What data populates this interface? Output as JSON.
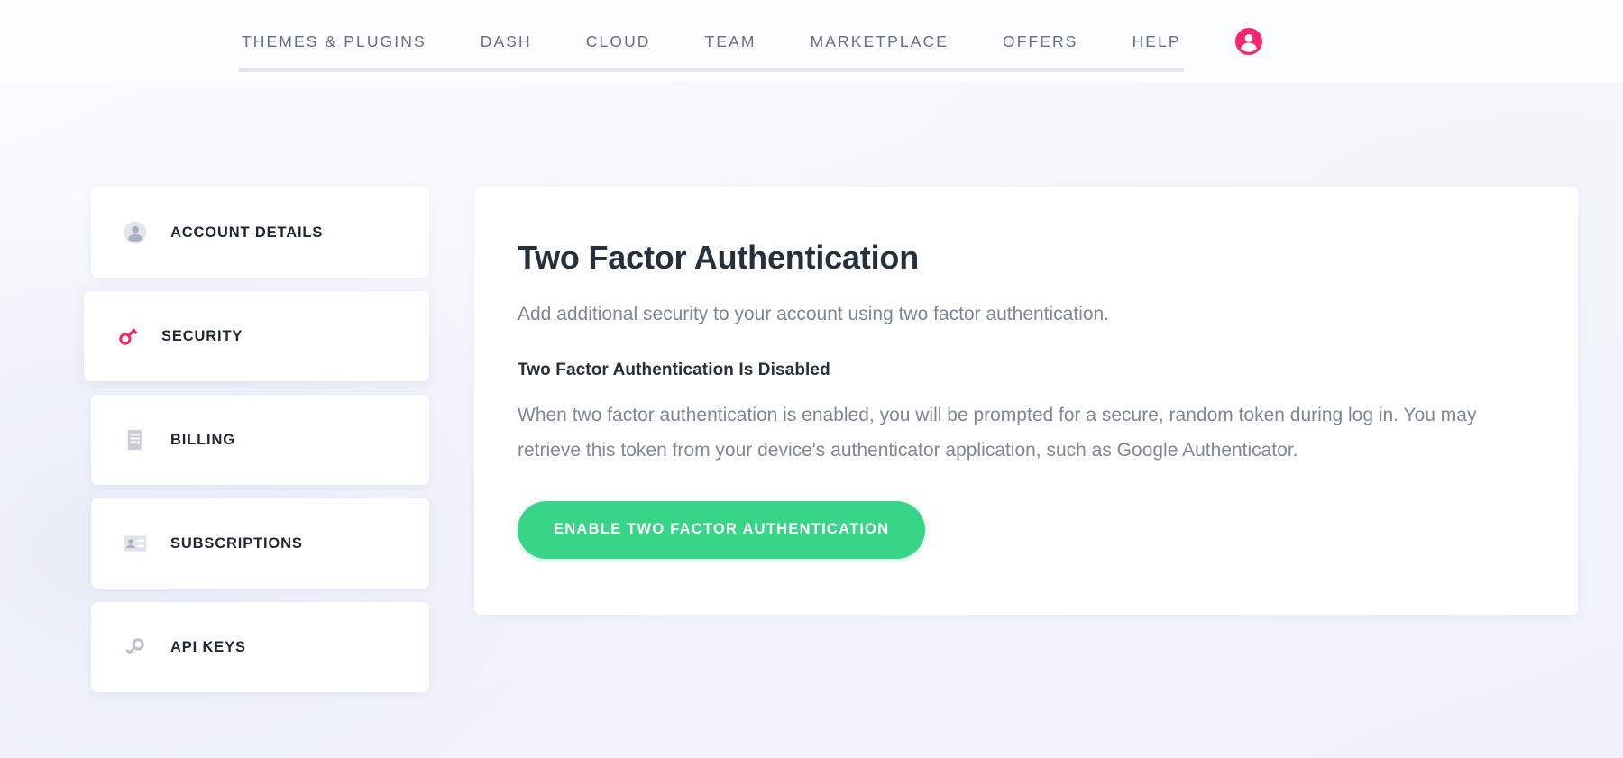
{
  "nav": {
    "items": [
      {
        "label": "THEMES & PLUGINS",
        "name": "nav-item-themes-plugins"
      },
      {
        "label": "DASH",
        "name": "nav-item-dash"
      },
      {
        "label": "CLOUD",
        "name": "nav-item-cloud"
      },
      {
        "label": "TEAM",
        "name": "nav-item-team"
      },
      {
        "label": "MARKETPLACE",
        "name": "nav-item-marketplace"
      },
      {
        "label": "OFFERS",
        "name": "nav-item-offers"
      },
      {
        "label": "HELP",
        "name": "nav-item-help"
      }
    ],
    "avatar_icon": "user-avatar-icon"
  },
  "sidebar": {
    "items": [
      {
        "label": "ACCOUNT DETAILS",
        "icon": "user-avatar-icon",
        "active": false
      },
      {
        "label": "SECURITY",
        "icon": "key-icon",
        "active": true
      },
      {
        "label": "BILLING",
        "icon": "receipt-icon",
        "active": false
      },
      {
        "label": "SUBSCRIPTIONS",
        "icon": "id-card-icon",
        "active": false
      },
      {
        "label": "API KEYS",
        "icon": "key-icon",
        "active": false
      }
    ]
  },
  "main": {
    "title": "Two Factor Authentication",
    "subtitle": "Add additional security to your account using two factor authentication.",
    "status_heading": "Two Factor Authentication Is Disabled",
    "description": "When two factor authentication is enabled, you will be prompted for a secure, random token during log in. You may retrieve this token from your device's authenticator application, such as Google Authenticator.",
    "enable_button_label": "ENABLE TWO FACTOR AUTHENTICATION"
  },
  "colors": {
    "accent_pink": "#f5276f",
    "button_green": "#38d487",
    "nav_text": "#656e85",
    "body_text": "#7d8799",
    "heading_text": "#26303c",
    "page_bg": "#f6f8fc",
    "card_bg": "#ffffff",
    "icon_gray": "#b9c0cc"
  }
}
